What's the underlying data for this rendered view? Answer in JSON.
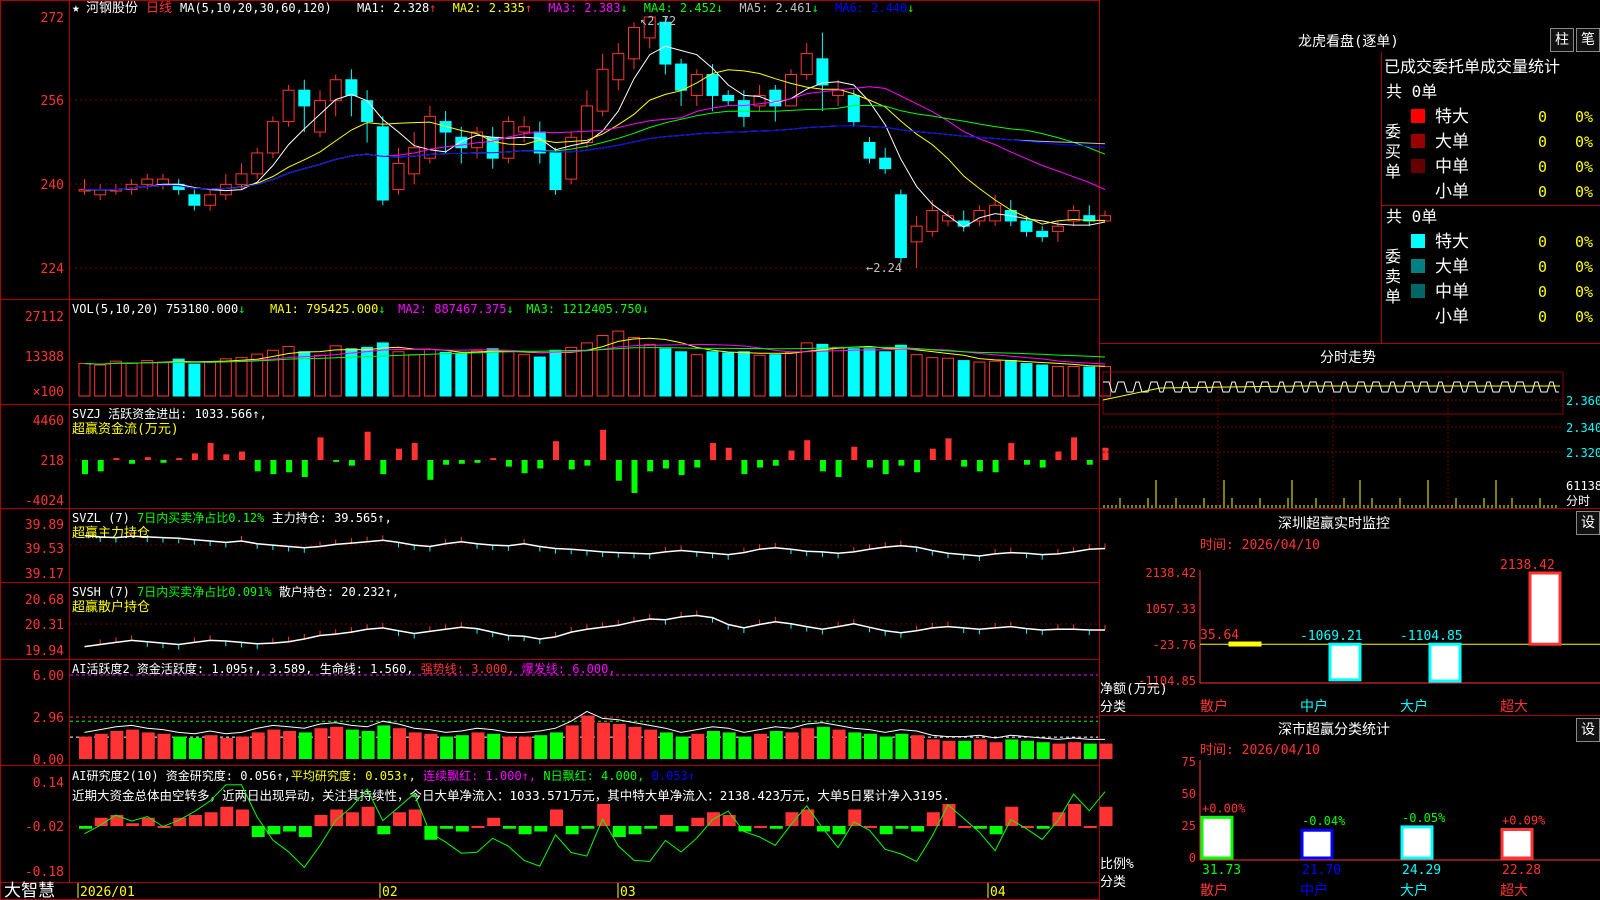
{
  "stock": {
    "name": "河钢股份",
    "period": "日线"
  },
  "ma_header": {
    "label": "MA(5,10,20,30,60,120)",
    "items": [
      {
        "label": "MA1:",
        "value": "2.328",
        "arrow": "↑",
        "color": "#ffffff"
      },
      {
        "label": "MA2:",
        "value": "2.335",
        "arrow": "↑",
        "color": "#ffff00"
      },
      {
        "label": "MA3:",
        "value": "2.383",
        "arrow": "↓",
        "color": "#ff00ff"
      },
      {
        "label": "MA4:",
        "value": "2.452",
        "arrow": "↓",
        "color": "#00ff00"
      },
      {
        "label": "MA5:",
        "value": "2.461",
        "arrow": "↓",
        "color": "#c0c0c0"
      },
      {
        "label": "MA6:",
        "value": "2.440",
        "arrow": "↓",
        "color": "#0000ff"
      }
    ]
  },
  "price_axis": [
    "272",
    "256",
    "240",
    "224"
  ],
  "price_marks": {
    "high": "2.72",
    "low": "2.24"
  },
  "vol_header": {
    "label": "VOL(5,10,20)",
    "value": "753180.000",
    "arrow": "↓",
    "items": [
      {
        "label": "MA1:",
        "value": "795425.000",
        "arrow": "↓",
        "color": "#ffff00"
      },
      {
        "label": "MA2:",
        "value": "887467.375",
        "arrow": "↓",
        "color": "#ff00ff"
      },
      {
        "label": "MA3:",
        "value": "1212405.750",
        "arrow": "↓",
        "color": "#00ff00"
      }
    ]
  },
  "vol_axis": [
    "27112",
    "13388",
    "×100"
  ],
  "svzj": {
    "header": "SVZJ  活跃资金进出: 1033.566↑,",
    "sub": "超赢资金流(万元)",
    "axis": [
      "4460",
      "218",
      "-4024"
    ]
  },
  "svzl": {
    "header": "SVZL (7) ",
    "ratio": "7日内买卖净占比0.12%",
    "hold": "主力持仓: 39.565↑,",
    "sub": "超赢主力持仓",
    "axis": [
      "39.89",
      "39.53",
      "39.17"
    ]
  },
  "svsh": {
    "header": "SVSH (7) ",
    "ratio": "7日内买卖净占比0.091%",
    "hold": "散户持仓: 20.232↑,",
    "sub": "超赢散户持仓",
    "axis": [
      "20.68",
      "20.31",
      "19.94"
    ]
  },
  "ai_active": {
    "header": "AI活跃度2 资金活跃度: 1.095↑, 3.589, 生命线: 1.560, ",
    "strong": "强势线: 3.000, ",
    "burst": "爆发线: 6.000,",
    "axis": [
      "6.00",
      "2.96",
      "0.00"
    ]
  },
  "ai_research": {
    "header": "AI研究度2(10) 资金研究度: 0.056↑,",
    "avg": "平均研究度: 0.053↑,",
    "red": "连续飘红: 1.000↑,",
    "nred": "N日飘红: 4.000,",
    "val": "0.053↑",
    "comment": "近期大资金总体由空转多，近两日出现异动，关注其持续性，今日大单净流入：1033.571万元，其中特大单净流入：2138.423万元，大单5日累计净入3195.",
    "axis": [
      "0.14",
      "-0.02",
      "-0.18"
    ]
  },
  "date_axis": [
    "2026/01",
    "02",
    "03",
    "04"
  ],
  "brand": "大智慧",
  "panel_lhb": {
    "title": "龙虎看盘(逐单)",
    "btn1": "柱",
    "btn2": "笔",
    "header": "已成交委托单成交量统计",
    "buy": {
      "side": "委买单",
      "total": "共 0单",
      "rows": [
        {
          "label": "特大",
          "count": "0",
          "pct": "0%",
          "color": "#ff0000"
        },
        {
          "label": "大单",
          "count": "0",
          "pct": "0%",
          "color": "#990000"
        },
        {
          "label": "中单",
          "count": "0",
          "pct": "0%",
          "color": "#660000"
        },
        {
          "label": "小单",
          "count": "0",
          "pct": "0%",
          "color": ""
        }
      ]
    },
    "sell": {
      "side": "委卖单",
      "total": "共 0单",
      "rows": [
        {
          "label": "特大",
          "count": "0",
          "pct": "0%",
          "color": "#00ffff"
        },
        {
          "label": "大单",
          "count": "0",
          "pct": "0%",
          "color": "#008080"
        },
        {
          "label": "中单",
          "count": "0",
          "pct": "0%",
          "color": "#006666"
        },
        {
          "label": "小单",
          "count": "0",
          "pct": "0%",
          "color": ""
        }
      ]
    }
  },
  "intraday": {
    "title": "分时走势",
    "axis": [
      "2.360",
      "2.340",
      "2.320"
    ],
    "vol_label": "61138",
    "vol_unit": "分时"
  },
  "sz_monitor": {
    "title": "深圳超赢实时监控",
    "btn": "设",
    "time": "时间: 2026/04/10",
    "axis": [
      "2138.42",
      "1057.33",
      "-23.76",
      "-1104.85"
    ],
    "ylabel": "净额(万元)",
    "xlabel": "分类",
    "categories": [
      "散户",
      "中户",
      "大户",
      "超大"
    ],
    "values": [
      35.64,
      -1069.21,
      -1104.85,
      2138.42
    ],
    "value_labels": [
      "35.64",
      "-1069.21",
      "-1104.85",
      "2138.42"
    ]
  },
  "sz_stats": {
    "title": "深市超赢分类统计",
    "btn": "设",
    "time": "时间: 2026/04/10",
    "axis": [
      "75",
      "50",
      "25",
      "0"
    ],
    "ylabel": "比例%",
    "xlabel": "分类",
    "categories": [
      "散户",
      "中户",
      "大户",
      "超大"
    ],
    "changes": [
      "+0.00%",
      "-0.04%",
      "-0.05%",
      "+0.09%"
    ],
    "values": [
      31.73,
      21.7,
      24.29,
      22.28
    ],
    "value_labels": [
      "31.73",
      "21.70",
      "24.29",
      "22.28"
    ]
  },
  "chart_data": {
    "type": "bar",
    "candles": [
      [
        2.39,
        2.39,
        2.38,
        2.41
      ],
      [
        2.38,
        2.39,
        2.37,
        2.4
      ],
      [
        2.39,
        2.39,
        2.38,
        2.4
      ],
      [
        2.39,
        2.4,
        2.38,
        2.41
      ],
      [
        2.4,
        2.41,
        2.39,
        2.42
      ],
      [
        2.4,
        2.41,
        2.39,
        2.42
      ],
      [
        2.4,
        2.39,
        2.38,
        2.41
      ],
      [
        2.38,
        2.36,
        2.35,
        2.39
      ],
      [
        2.36,
        2.38,
        2.35,
        2.39
      ],
      [
        2.38,
        2.4,
        2.37,
        2.42
      ],
      [
        2.4,
        2.42,
        2.39,
        2.44
      ],
      [
        2.42,
        2.46,
        2.41,
        2.47
      ],
      [
        2.46,
        2.52,
        2.45,
        2.53
      ],
      [
        2.52,
        2.58,
        2.51,
        2.59
      ],
      [
        2.58,
        2.55,
        2.5,
        2.6
      ],
      [
        2.5,
        2.56,
        2.49,
        2.58
      ],
      [
        2.56,
        2.6,
        2.53,
        2.61
      ],
      [
        2.6,
        2.57,
        2.53,
        2.62
      ],
      [
        2.56,
        2.52,
        2.48,
        2.58
      ],
      [
        2.51,
        2.37,
        2.36,
        2.53
      ],
      [
        2.39,
        2.44,
        2.38,
        2.47
      ],
      [
        2.42,
        2.47,
        2.4,
        2.5
      ],
      [
        2.45,
        2.53,
        2.44,
        2.55
      ],
      [
        2.52,
        2.5,
        2.46,
        2.54
      ],
      [
        2.49,
        2.47,
        2.44,
        2.51
      ],
      [
        2.47,
        2.5,
        2.45,
        2.51
      ],
      [
        2.49,
        2.45,
        2.43,
        2.51
      ],
      [
        2.45,
        2.52,
        2.44,
        2.53
      ],
      [
        2.5,
        2.51,
        2.48,
        2.53
      ],
      [
        2.5,
        2.46,
        2.44,
        2.52
      ],
      [
        2.46,
        2.39,
        2.38,
        2.47
      ],
      [
        2.41,
        2.49,
        2.4,
        2.5
      ],
      [
        2.48,
        2.55,
        2.47,
        2.58
      ],
      [
        2.54,
        2.62,
        2.53,
        2.65
      ],
      [
        2.6,
        2.65,
        2.58,
        2.67
      ],
      [
        2.64,
        2.7,
        2.62,
        2.71
      ],
      [
        2.68,
        2.72,
        2.66,
        2.72
      ],
      [
        2.71,
        2.63,
        2.61,
        2.72
      ],
      [
        2.63,
        2.58,
        2.55,
        2.64
      ],
      [
        2.57,
        2.61,
        2.55,
        2.62
      ],
      [
        2.61,
        2.57,
        2.54,
        2.63
      ],
      [
        2.57,
        2.56,
        2.55,
        2.58
      ],
      [
        2.56,
        2.53,
        2.51,
        2.58
      ],
      [
        2.55,
        2.57,
        2.54,
        2.59
      ],
      [
        2.58,
        2.55,
        2.52,
        2.59
      ],
      [
        2.55,
        2.61,
        2.55,
        2.62
      ],
      [
        2.61,
        2.65,
        2.6,
        2.67
      ],
      [
        2.64,
        2.59,
        2.54,
        2.69
      ],
      [
        2.57,
        2.58,
        2.55,
        2.6
      ],
      [
        2.57,
        2.52,
        2.51,
        2.58
      ],
      [
        2.48,
        2.45,
        2.44,
        2.49
      ],
      [
        2.45,
        2.43,
        2.42,
        2.47
      ],
      [
        2.38,
        2.26,
        2.25,
        2.39
      ],
      [
        2.29,
        2.32,
        2.24,
        2.34
      ],
      [
        2.31,
        2.35,
        2.3,
        2.37
      ],
      [
        2.33,
        2.34,
        2.32,
        2.35
      ],
      [
        2.33,
        2.32,
        2.31,
        2.35
      ],
      [
        2.33,
        2.35,
        2.32,
        2.36
      ],
      [
        2.33,
        2.36,
        2.32,
        2.38
      ],
      [
        2.35,
        2.33,
        2.32,
        2.37
      ],
      [
        2.33,
        2.31,
        2.3,
        2.34
      ],
      [
        2.31,
        2.3,
        2.29,
        2.32
      ],
      [
        2.31,
        2.32,
        2.29,
        2.33
      ],
      [
        2.33,
        2.35,
        2.32,
        2.36
      ],
      [
        2.34,
        2.33,
        2.32,
        2.36
      ],
      [
        2.33,
        2.34,
        2.33,
        2.35
      ]
    ],
    "volume": [
      110,
      105,
      118,
      112,
      120,
      115,
      125,
      108,
      117,
      126,
      130,
      142,
      155,
      168,
      150,
      138,
      170,
      160,
      165,
      180,
      150,
      140,
      158,
      148,
      145,
      152,
      160,
      150,
      140,
      132,
      155,
      165,
      180,
      205,
      220,
      198,
      175,
      160,
      150,
      140,
      150,
      146,
      150,
      138,
      140,
      148,
      180,
      175,
      165,
      160,
      160,
      150,
      172,
      140,
      130,
      128,
      120,
      115,
      118,
      120,
      110,
      105,
      100,
      100,
      98,
      100
    ],
    "flow": [
      -1500,
      -1200,
      200,
      -400,
      300,
      -300,
      200,
      700,
      1800,
      600,
      900,
      -1200,
      -1500,
      -1300,
      -1800,
      2400,
      -200,
      -600,
      3000,
      -1500,
      1200,
      1800,
      -2100,
      -500,
      -400,
      -300,
      200,
      -700,
      -1400,
      -900,
      2000,
      -1000,
      -600,
      3200,
      -2200,
      -3500,
      -1200,
      -900,
      -1600,
      -800,
      1800,
      1300,
      -1500,
      -800,
      -600,
      1000,
      2100,
      -1200,
      -1800,
      1400,
      -800,
      -1500,
      -600,
      -1300,
      1200,
      2300,
      -700,
      -1200,
      -1300,
      1800,
      -500,
      -800,
      900,
      2400,
      -500,
      1300
    ],
    "svzl": [
      39.72,
      39.7,
      39.69,
      39.71,
      39.7,
      39.69,
      39.68,
      39.66,
      39.64,
      39.62,
      39.64,
      39.6,
      39.58,
      39.56,
      39.54,
      39.56,
      39.59,
      39.61,
      39.63,
      39.65,
      39.62,
      39.58,
      39.56,
      39.6,
      39.63,
      39.6,
      39.58,
      39.57,
      39.6,
      39.56,
      39.53,
      39.52,
      39.5,
      39.48,
      39.47,
      39.46,
      39.45,
      39.48,
      39.5,
      39.48,
      39.46,
      39.44,
      39.47,
      39.52,
      39.54,
      39.52,
      39.49,
      39.48,
      39.46,
      39.48,
      39.52,
      39.55,
      39.57,
      39.55,
      39.5,
      39.46,
      39.44,
      39.42,
      39.45,
      39.47,
      39.46,
      39.44,
      39.45,
      39.48,
      39.52,
      39.53
    ],
    "svsh": [
      19.99,
      20.02,
      20.05,
      20.08,
      20.06,
      20.04,
      20.02,
      20.05,
      20.08,
      20.07,
      20.05,
      20.03,
      20.04,
      20.06,
      20.1,
      20.15,
      20.17,
      20.2,
      20.24,
      20.26,
      20.22,
      20.18,
      20.21,
      20.24,
      20.27,
      20.25,
      20.2,
      20.15,
      20.14,
      20.1,
      20.13,
      20.2,
      20.24,
      20.27,
      20.3,
      20.35,
      20.39,
      20.38,
      20.42,
      20.44,
      20.41,
      20.31,
      20.26,
      20.31,
      20.35,
      20.32,
      20.28,
      20.24,
      20.28,
      20.32,
      20.27,
      20.22,
      20.19,
      20.22,
      20.26,
      20.28,
      20.26,
      20.24,
      20.26,
      20.28,
      20.25,
      20.23,
      20.24,
      20.24,
      20.23,
      20.23
    ],
    "active": [
      1.6,
      1.8,
      2.0,
      2.1,
      1.9,
      1.8,
      1.6,
      1.5,
      1.7,
      1.5,
      1.6,
      1.9,
      2.1,
      2.0,
      1.9,
      2.2,
      2.3,
      2.1,
      2.0,
      2.4,
      2.2,
      1.9,
      1.8,
      1.6,
      1.7,
      1.9,
      1.8,
      1.6,
      1.6,
      1.7,
      1.9,
      2.4,
      3.1,
      2.6,
      2.5,
      2.3,
      2.1,
      1.9,
      1.6,
      1.8,
      2.0,
      1.9,
      1.6,
      1.8,
      2.0,
      1.9,
      2.2,
      2.3,
      2.1,
      1.9,
      1.8,
      1.6,
      1.8,
      1.7,
      1.4,
      1.3,
      1.3,
      1.4,
      1.2,
      1.4,
      1.3,
      1.2,
      1.1,
      1.2,
      1.1,
      1.1
    ],
    "research": [
      -0.03,
      0.01,
      0.02,
      -0.01,
      0.01,
      -0.02,
      0.01,
      0.02,
      0.03,
      0.05,
      0.04,
      -0.06,
      -0.05,
      -0.04,
      -0.06,
      0.02,
      0.04,
      0.03,
      0.05,
      -0.05,
      0.03,
      0.04,
      -0.07,
      -0.03,
      -0.04,
      -0.02,
      0.01,
      -0.03,
      -0.05,
      -0.04,
      0.04,
      -0.05,
      -0.03,
      0.06,
      -0.06,
      -0.05,
      -0.03,
      0.02,
      -0.04,
      0.01,
      0.03,
      0.02,
      -0.04,
      -0.02,
      -0.03,
      0.03,
      0.04,
      -0.04,
      -0.05,
      0.04,
      -0.02,
      -0.05,
      -0.03,
      -0.04,
      0.03,
      0.06,
      -0.02,
      -0.03,
      -0.05,
      0.05,
      -0.02,
      -0.03,
      0.03,
      0.06,
      -0.02,
      0.05
    ]
  },
  "colors": {
    "up": "#ff3333",
    "down": "#00ffff",
    "grid": "#8b0000",
    "axis_text": "#ff3333",
    "green": "#00ff00"
  }
}
